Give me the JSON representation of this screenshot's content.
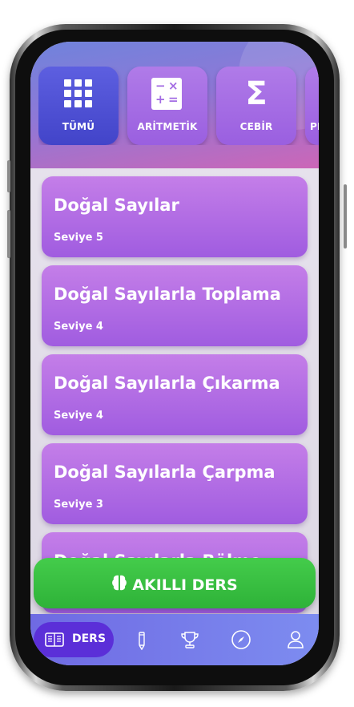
{
  "categories": [
    {
      "label": "TÜMÜ",
      "icon": "grid-icon",
      "active": true
    },
    {
      "label": "ARİTMETİK",
      "icon": "calculator-icon",
      "active": false
    },
    {
      "label": "CEBİR",
      "icon": "sigma-icon",
      "active": false
    },
    {
      "label": "PI",
      "icon": "partial-icon",
      "active": false
    }
  ],
  "lessons": [
    {
      "title": "Doğal Sayılar",
      "level": "Seviye 5"
    },
    {
      "title": "Doğal Sayılarla Toplama",
      "level": "Seviye 4"
    },
    {
      "title": "Doğal Sayılarla Çıkarma",
      "level": "Seviye 4"
    },
    {
      "title": "Doğal Sayılarla Çarpma",
      "level": "Seviye 3"
    },
    {
      "title": "Doğal Sayılarla Bölme",
      "level": ""
    }
  ],
  "ai_button": {
    "label": "AKILLI DERS",
    "icon": "brain-icon"
  },
  "tabbar": {
    "items": [
      {
        "label": "DERS",
        "icon": "book-icon",
        "active": true
      },
      {
        "label": "",
        "icon": "pencil-icon",
        "active": false
      },
      {
        "label": "",
        "icon": "trophy-icon",
        "active": false
      },
      {
        "label": "",
        "icon": "compass-icon",
        "active": false
      },
      {
        "label": "",
        "icon": "user-icon",
        "active": false
      }
    ]
  },
  "colors": {
    "accent": "#9a5fe0",
    "active_category": "#4244c9",
    "ai_button": "#3ac043",
    "tabbar_active": "#5b2fd8"
  }
}
